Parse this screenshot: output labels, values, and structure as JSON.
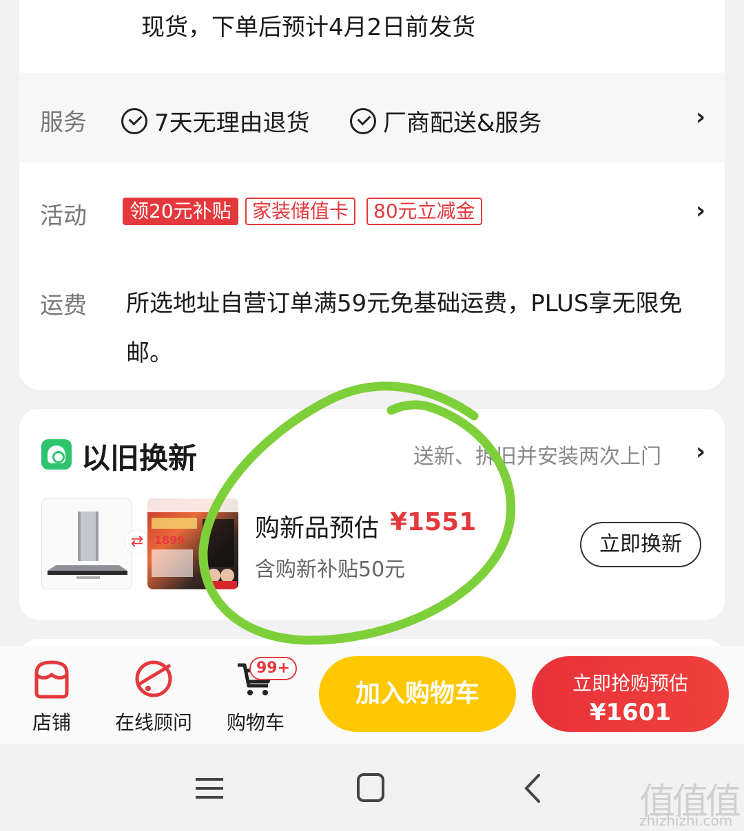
{
  "delivery": {
    "text": "现货，下单后预计4月2日前发货"
  },
  "service": {
    "label": "服务",
    "items": [
      "7天无理由退货",
      "厂商配送&服务"
    ]
  },
  "activity": {
    "label": "活动",
    "tags": [
      "领20元补贴",
      "家装储值卡",
      "80元立减金"
    ]
  },
  "shipping": {
    "label": "运费",
    "text": "所选地址自营订单满59元免基础运费，PLUS享无限免邮。"
  },
  "trade_in": {
    "title": "以旧换新",
    "note": "送新、拆旧并安装两次上门",
    "estimate_label": "购新品预估",
    "estimate_price": "¥1551",
    "subsidy": "含购新补贴50元",
    "button": "立即换新",
    "new_thumb_price": "1899"
  },
  "bottom_bar": {
    "store": "店铺",
    "consult": "在线顾问",
    "cart": "购物车",
    "cart_badge": "99+",
    "add_to_cart": "加入购物车",
    "buy_label": "立即抢购预估",
    "buy_price": "¥1601"
  },
  "watermark": {
    "site": "zhizhizhi.com",
    "glyph": "值值值"
  },
  "colors": {
    "accent_red": "#e4393c",
    "cart_yellow": "#fdc800",
    "trade_green": "#2ec46d",
    "annotation_green": "#7ed03a"
  },
  "icons": [
    "check-circle-icon",
    "chevron-right-icon",
    "trade-in-icon",
    "swap-icon",
    "store-icon",
    "consult-icon",
    "cart-icon",
    "menu-icon",
    "home-icon",
    "back-icon"
  ]
}
